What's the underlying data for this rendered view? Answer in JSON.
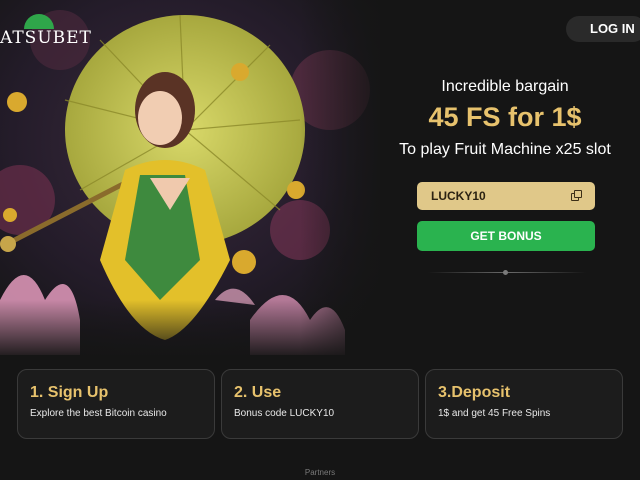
{
  "header": {
    "logo_text": "ATSUBET",
    "login_label": "LOG IN"
  },
  "offer": {
    "subtitle": "Incredible bargain",
    "amount": "45 FS for 1$",
    "description": "To play Fruit Machine x25 slot",
    "promo_code": "LUCKY10",
    "cta_label": "GET BONUS"
  },
  "steps": [
    {
      "title": "1. Sign Up",
      "description": "Explore the best Bitcoin casino"
    },
    {
      "title": "2. Use",
      "description": "Bonus code LUCKY10"
    },
    {
      "title": "3.Deposit",
      "description": "1$ and get 45 Free Spins"
    }
  ],
  "footer": {
    "partners_label": "Partners"
  },
  "colors": {
    "background": "#151515",
    "accent_gold": "#e7c26d",
    "code_box": "#e0c889",
    "cta_green": "#2ab34f"
  },
  "icons": {
    "copy": "copy-icon"
  }
}
